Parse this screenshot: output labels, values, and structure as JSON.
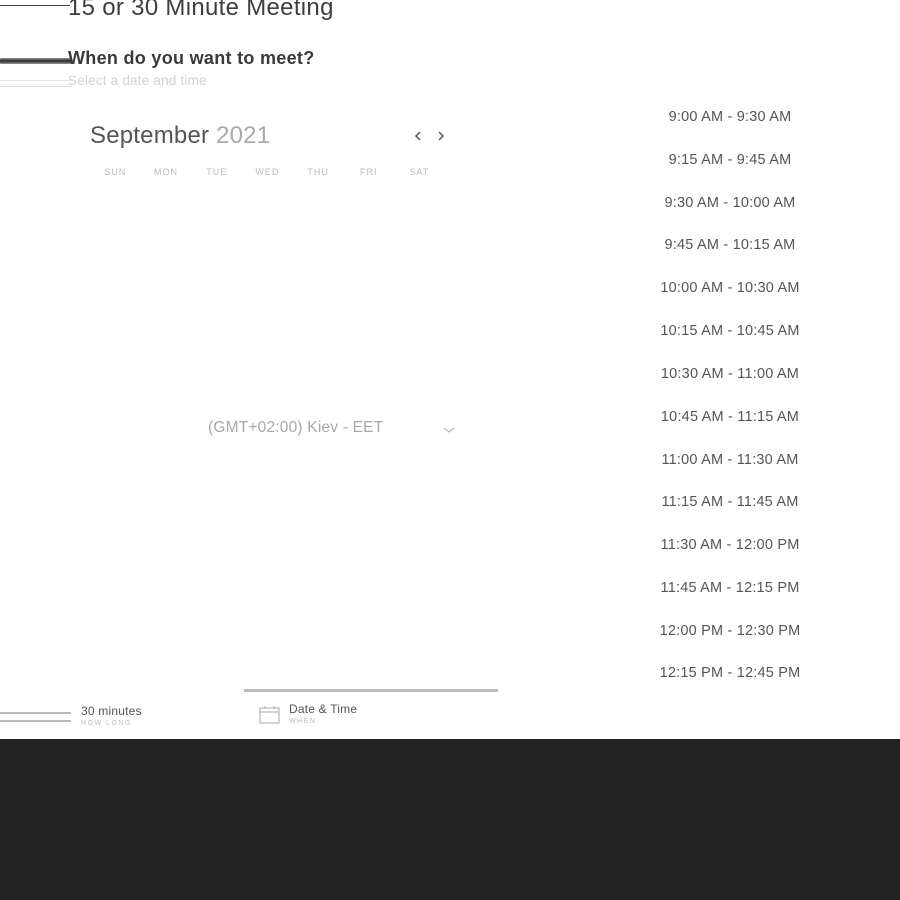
{
  "header": {
    "title": "15 or 30 Minute Meeting",
    "subtitle": "When do you want to meet?",
    "hint": "Select a date and time"
  },
  "calendar": {
    "month": "September",
    "year": "2021",
    "prev_icon": "chevron-left-icon",
    "next_icon": "chevron-right-icon",
    "days_of_week": [
      "SUN",
      "MON",
      "TUE",
      "WED",
      "THU",
      "FRI",
      "SAT"
    ]
  },
  "timezone": {
    "selected": "(GMT+02:00) Kiev - EET",
    "icon": "chevron-down-icon"
  },
  "time_slots": [
    "9:00 AM - 9:30 AM",
    "9:15 AM - 9:45 AM",
    "9:30 AM - 10:00 AM",
    "9:45 AM - 10:15 AM",
    "10:00 AM - 10:30 AM",
    "10:15 AM - 10:45 AM",
    "10:30 AM - 11:00 AM",
    "10:45 AM - 11:15 AM",
    "11:00 AM - 11:30 AM",
    "11:15 AM - 11:45 AM",
    "11:30 AM - 12:00 PM",
    "11:45 AM - 12:15 PM",
    "12:00 PM - 12:30 PM",
    "12:15 PM - 12:45 PM"
  ],
  "steps": {
    "duration": {
      "title": "30 minutes",
      "subtitle": "HOW LONG"
    },
    "datetime": {
      "title": "Date & Time",
      "subtitle": "WHEN",
      "icon": "calendar-icon"
    }
  },
  "colors": {
    "footer_bg": "#212121",
    "text": "#555555",
    "muted": "#aaaaaa"
  }
}
